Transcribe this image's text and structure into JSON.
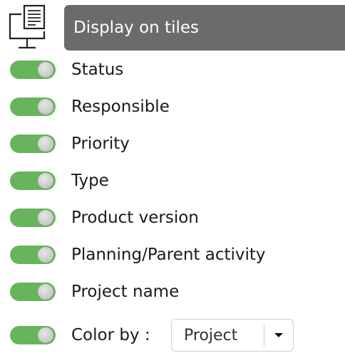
{
  "header": {
    "icon": "monitor-document-icon",
    "title": "Display on tiles"
  },
  "toggles": [
    {
      "label": "Status",
      "on": true
    },
    {
      "label": "Responsible",
      "on": true
    },
    {
      "label": "Priority",
      "on": true
    },
    {
      "label": "Type",
      "on": true
    },
    {
      "label": "Product version",
      "on": true
    },
    {
      "label": "Planning/Parent activity",
      "on": true
    },
    {
      "label": "Project name",
      "on": true
    }
  ],
  "color_by": {
    "on": true,
    "label": "Color by :",
    "selected": "Project"
  },
  "colors": {
    "toggle_on": "#68b45c",
    "header_bg": "#6b6b6b",
    "header_text": "#ffffff"
  }
}
